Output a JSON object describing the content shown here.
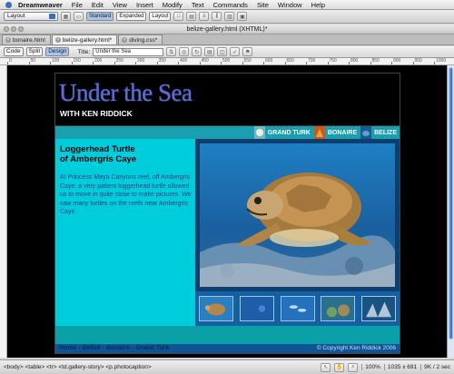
{
  "menubar": {
    "app": "Dreamweaver",
    "items": [
      "File",
      "Edit",
      "View",
      "Insert",
      "Modify",
      "Text",
      "Commands",
      "Site",
      "Window",
      "Help"
    ]
  },
  "insertbar": {
    "category": "Layout",
    "modes": [
      "Standard",
      "Expanded",
      "Layout"
    ],
    "active_mode": "Standard"
  },
  "window": {
    "title": "belize-gallery.html (XHTML)*"
  },
  "doc_tabs": [
    "bonaire.html",
    "belize-gallery.html*",
    "diving.css*"
  ],
  "doc_toolbar": {
    "views": [
      "Code",
      "Split",
      "Design"
    ],
    "active_view": "Design",
    "title_label": "Title:",
    "title_value": "Under the Sea"
  },
  "ruler": {
    "marks": [
      "0",
      "50",
      "100",
      "150",
      "200",
      "250",
      "300",
      "350",
      "400",
      "450",
      "500",
      "550",
      "600",
      "650",
      "700",
      "750",
      "800",
      "850",
      "900",
      "950",
      "1000"
    ]
  },
  "site": {
    "banner_title": "Under the Sea",
    "banner_subtitle": "WITH KEN RIDDICK",
    "nav": [
      "GRAND TURK",
      "BONAIRE",
      "BELIZE"
    ],
    "story_heading_line1": "Loggerhead Turtle",
    "story_heading_line2": "of Ambergris Caye",
    "story_text": "At Princess Maya Canyons reef, off Ambergris Caye, a very patient loggerhead turtle allowed us to move in quite close to make pictures. We saw many turtles on the reefs near Ambergris Caye.",
    "footer_links": "Home - Belize - Bonaire - Grand Turk",
    "footer_copyright": "© Copyright Ken Riddick 2006"
  },
  "status": {
    "tag_selector": "<body> <table> <tr> <td.gallery-story> <p.photocaption>",
    "zoom": "100%",
    "size": "1035 x 691",
    "download": "9K / 2 sec"
  },
  "colors": {
    "accent_cyan": "#00cddc",
    "nav_teal": "#1a9fb0",
    "footer_blue": "#0f5595",
    "title_purple": "#5c6ad6"
  }
}
